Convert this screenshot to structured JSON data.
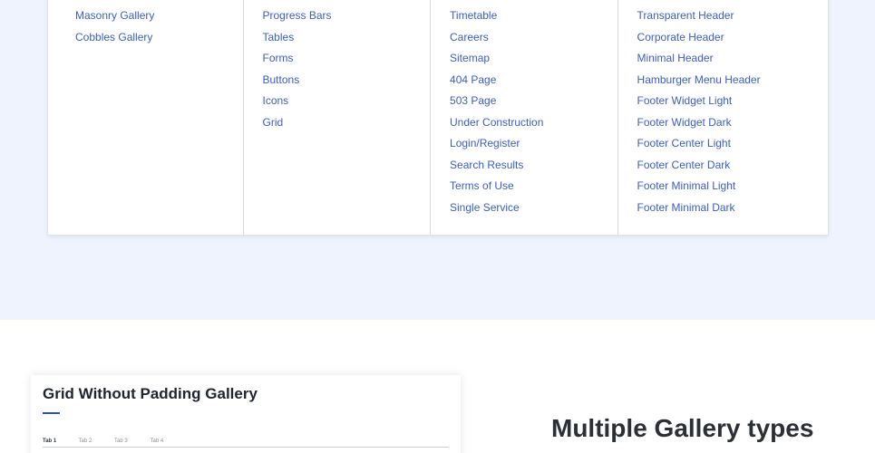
{
  "menu": {
    "columns": [
      {
        "items": [
          "Masonry Gallery",
          "Cobbles Gallery"
        ]
      },
      {
        "items": [
          "Progress Bars",
          "Tables",
          "Forms",
          "Buttons",
          "Icons",
          "Grid"
        ]
      },
      {
        "items": [
          "Timetable",
          "Careers",
          "Sitemap",
          "404 Page",
          "503 Page",
          "Under Construction",
          "Login/Register",
          "Search Results",
          "Terms of Use",
          "Single Service"
        ]
      },
      {
        "items": [
          "Transparent Header",
          "Corporate Header",
          "Minimal Header",
          "Hamburger Menu Header",
          "Footer Widget Light",
          "Footer Widget Dark",
          "Footer Center Light",
          "Footer Center Dark",
          "Footer Minimal Light",
          "Footer Minimal Dark"
        ]
      }
    ]
  },
  "gallery": {
    "title": "Grid Without Padding Gallery",
    "tabs": [
      "Tab 1",
      "Tab 2",
      "Tab 3",
      "Tab 4"
    ]
  },
  "section": {
    "heading": "Multiple Gallery types"
  },
  "colors": {
    "link": "#3a5ec6",
    "band_background": "#eef3fd",
    "accent": "#2a4fc9"
  }
}
